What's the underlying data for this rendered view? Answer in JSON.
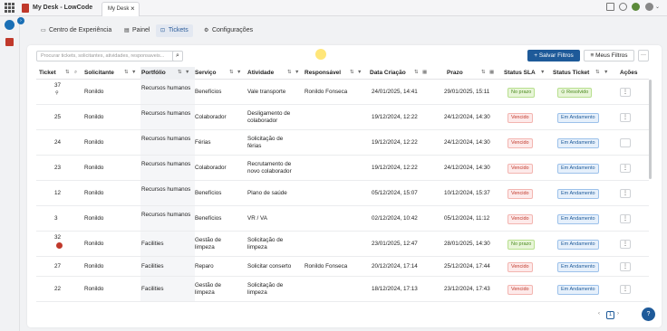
{
  "window": {
    "app_title": "My Desk - LowCode",
    "tab_label": "My Desk",
    "tab_close": "×"
  },
  "nav": [
    {
      "icon": "▭",
      "label": "Centro de Experiência"
    },
    {
      "icon": "▤",
      "label": "Painel"
    },
    {
      "icon": "⊡",
      "label": "Tickets"
    },
    {
      "icon": "⚙",
      "label": "Configurações"
    }
  ],
  "toolbar": {
    "search_placeholder": "Procurar tickets, solicitantes, atividades, responsaveis...",
    "save_filters": "+ Salvar Filtros",
    "my_filters": "≡ Meus Filtros",
    "more": "···"
  },
  "columns": [
    "Ticket",
    "Solicitante",
    "Portfólio",
    "Serviço",
    "Atividade",
    "Responsável",
    "Data Criação",
    "Prazo",
    "Status SLA",
    "Status Ticket",
    "Ações"
  ],
  "rows": [
    {
      "ticket": "37",
      "solicitante": "Ronildo",
      "portfolio": "Recursos humanos",
      "servico": "Benefícios",
      "atividade": "Vale transporte",
      "responsavel": "Ronildo Fonseca",
      "criacao": "24/01/2025, 14:41",
      "prazo": "29/01/2025, 15:11",
      "sla": "No prazo",
      "status": "Resolvido"
    },
    {
      "ticket": "25",
      "solicitante": "Ronildo",
      "portfolio": "Recursos humanos",
      "servico": "Colaborador",
      "atividade": "Desligamento de colaborador",
      "responsavel": "",
      "criacao": "19/12/2024, 12:22",
      "prazo": "24/12/2024, 14:30",
      "sla": "Vencido",
      "status": "Em Andamento"
    },
    {
      "ticket": "24",
      "solicitante": "Ronildo",
      "portfolio": "Recursos humanos",
      "servico": "Férias",
      "atividade": "Solicitação de férias",
      "responsavel": "",
      "criacao": "19/12/2024, 12:22",
      "prazo": "24/12/2024, 14:30",
      "sla": "Vencido",
      "status": "Em Andamento"
    },
    {
      "ticket": "23",
      "solicitante": "Ronildo",
      "portfolio": "Recursos humanos",
      "servico": "Colaborador",
      "atividade": "Recrutamento de novo colaborador",
      "responsavel": "",
      "criacao": "19/12/2024, 12:22",
      "prazo": "24/12/2024, 14:30",
      "sla": "Vencido",
      "status": "Em Andamento"
    },
    {
      "ticket": "12",
      "solicitante": "Ronildo",
      "portfolio": "Recursos humanos",
      "servico": "Benefícios",
      "atividade": "Plano de saúde",
      "responsavel": "",
      "criacao": "05/12/2024, 15:07",
      "prazo": "10/12/2024, 15:37",
      "sla": "Vencido",
      "status": "Em Andamento"
    },
    {
      "ticket": "3",
      "solicitante": "Ronildo",
      "portfolio": "Recursos humanos",
      "servico": "Benefícios",
      "atividade": "VR / VA",
      "responsavel": "",
      "criacao": "02/12/2024, 10:42",
      "prazo": "05/12/2024, 11:12",
      "sla": "Vencido",
      "status": "Em Andamento"
    },
    {
      "ticket": "32",
      "solicitante": "Ronildo",
      "portfolio": "Facilities",
      "servico": "Gestão de limpeza",
      "atividade": "Solicitação de limpeza",
      "responsavel": "",
      "criacao": "23/01/2025, 12:47",
      "prazo": "28/01/2025, 14:30",
      "sla": "No prazo",
      "status": "Em Andamento"
    },
    {
      "ticket": "27",
      "solicitante": "Ronildo",
      "portfolio": "Facilities",
      "servico": "Reparo",
      "atividade": "Solicitar conserto",
      "responsavel": "Ronildo Fonseca",
      "criacao": "20/12/2024, 17:14",
      "prazo": "25/12/2024, 17:44",
      "sla": "Vencido",
      "status": "Em Andamento"
    },
    {
      "ticket": "22",
      "solicitante": "Ronildo",
      "portfolio": "Facilities",
      "servico": "Gestão de limpeza",
      "atividade": "Solicitação de limpeza",
      "responsavel": "",
      "criacao": "18/12/2024, 17:13",
      "prazo": "23/12/2024, 17:43",
      "sla": "Vencido",
      "status": "Em Andamento"
    }
  ],
  "pager": {
    "prev": "‹",
    "page": "1",
    "next": "›"
  },
  "colors": {
    "primary": "#1e5a99",
    "sla_ok": "#4a8a1f",
    "sla_late": "#c0392b",
    "brand": "#c0392b"
  }
}
